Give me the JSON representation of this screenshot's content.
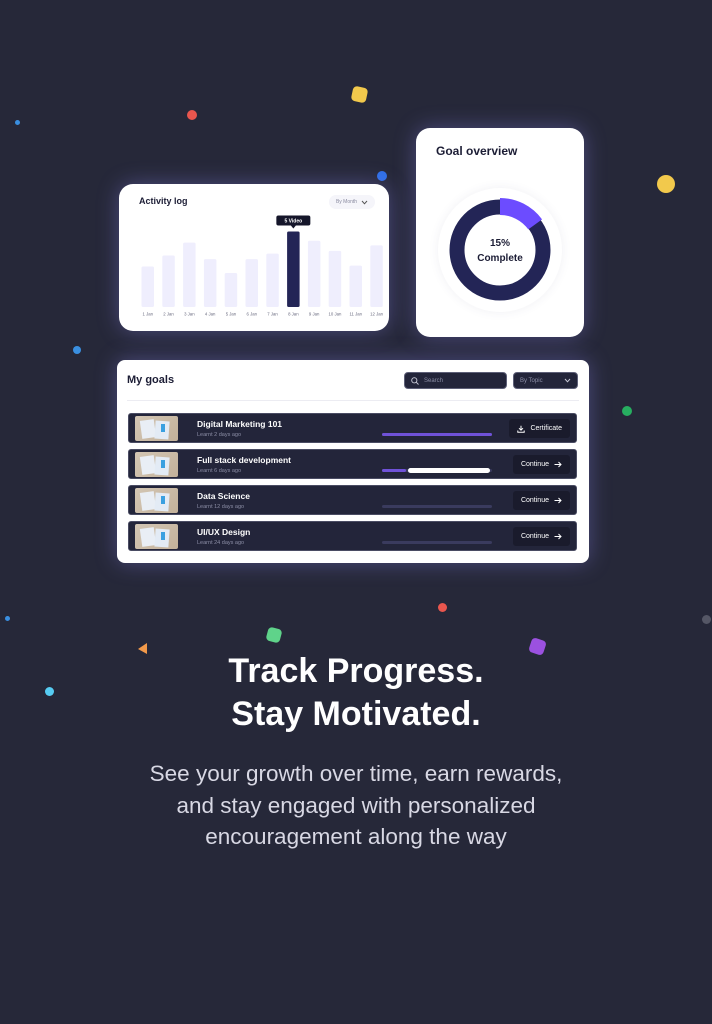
{
  "activity_log": {
    "title": "Activity log",
    "filter_label": "By Month",
    "tooltip": "5 Video",
    "highlight_index": 7,
    "chart_data": {
      "type": "bar",
      "categories": [
        "1 Jan",
        "2 Jan",
        "3 Jan",
        "4 Jan",
        "5 Jan",
        "6 Jan",
        "7 Jan",
        "8 Jan",
        "9 Jan",
        "10 Jan",
        "11 Jan",
        "12 Jan"
      ],
      "values": [
        44,
        56,
        70,
        52,
        37,
        52,
        58,
        82,
        72,
        61,
        45,
        67
      ]
    }
  },
  "goal_overview": {
    "title": "Goal overview",
    "percent": 15,
    "percent_label": "15%",
    "complete_label": "Complete"
  },
  "my_goals": {
    "title": "My goals",
    "search_placeholder": "Search",
    "topic_filter": "By Topic",
    "rows": [
      {
        "name": "Digital Marketing 101",
        "sub": "Learnt 2 days ago",
        "progress": 1.0,
        "action": "Certificate",
        "action_icon": "download-icon"
      },
      {
        "name": "Full stack development",
        "sub": "Learnt 6 days ago",
        "progress": 0.22,
        "action": "Continue",
        "action_icon": "arrow-right-icon"
      },
      {
        "name": "Data Science",
        "sub": "Learnt 12 days ago",
        "progress": 0.0,
        "action": "Continue",
        "action_icon": "arrow-right-icon"
      },
      {
        "name": "UI/UX Design",
        "sub": "Learnt 24 days ago",
        "progress": 0.0,
        "action": "Continue",
        "action_icon": "arrow-right-icon"
      }
    ]
  },
  "headline": {
    "line1": "Track Progress.",
    "line2": "Stay Motivated."
  },
  "body": {
    "line1": "See your growth over time, earn rewards,",
    "line2": "and stay engaged with personalized",
    "line3": "encouragement along the way"
  },
  "colors": {
    "background": "#262839",
    "accent": "#6c4cff",
    "navy": "#232556",
    "bar_light": "#efeefd"
  }
}
